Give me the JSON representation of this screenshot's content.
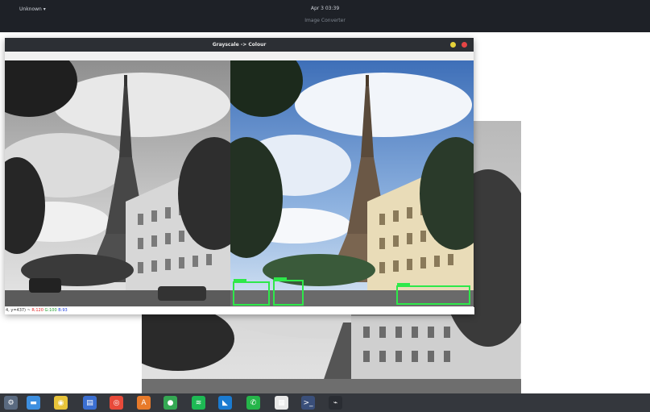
{
  "top_panel": {
    "left_label": "Unknown ▾",
    "clock": "Apr 3 03:39",
    "active_app": "Image Converter"
  },
  "window": {
    "title": "Grayscale -> Colour",
    "status": {
      "coords": "4, y=437) ~",
      "r": "R:120",
      "g": "G:100",
      "b": "B:93"
    }
  },
  "dock": {
    "apps": [
      {
        "name": "settings-icon",
        "glyph": "⚙",
        "color": "#5a6a80"
      },
      {
        "name": "files-icon",
        "glyph": "▬",
        "color": "#3d8fe0"
      },
      {
        "name": "rhythmbox-icon",
        "glyph": "◉",
        "color": "#e8c43a"
      },
      {
        "name": "document-icon",
        "glyph": "▤",
        "color": "#3b6fd1"
      },
      {
        "name": "help-lifebuoy-icon",
        "glyph": "◎",
        "color": "#e84a3a"
      },
      {
        "name": "software-center-icon",
        "glyph": "A",
        "color": "#e87a2a"
      },
      {
        "name": "chrome-icon",
        "glyph": "●",
        "color": "#34a853"
      },
      {
        "name": "spotify-icon",
        "glyph": "≋",
        "color": "#1db954"
      },
      {
        "name": "vscode-icon",
        "glyph": "◣",
        "color": "#1a7bd1"
      },
      {
        "name": "whatsapp-icon",
        "glyph": "✆",
        "color": "#25b54a"
      },
      {
        "name": "text-editor-icon",
        "glyph": "▦",
        "color": "#e8e8e8"
      },
      {
        "name": "terminal-icon",
        "glyph": ">_",
        "color": "#3a4f7a"
      },
      {
        "name": "system-monitor-icon",
        "glyph": "⌁",
        "color": "#2a2d33"
      }
    ]
  },
  "colors": {
    "panel": "#1e2127",
    "titlebar": "#2c2f34",
    "detection_box": "#2ee84a"
  }
}
